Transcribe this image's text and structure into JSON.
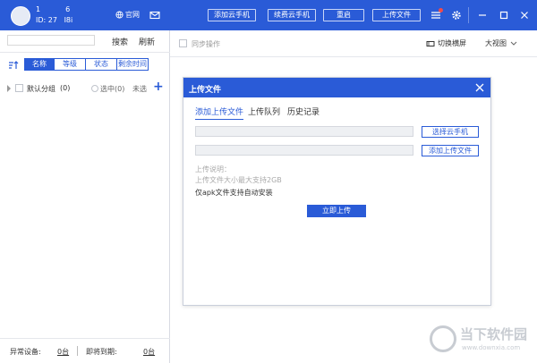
{
  "colors": {
    "accent": "#2a5bd7",
    "notify_dot": "#f24a4a"
  },
  "titlebar": {
    "user_name": "1           6",
    "user_id": "ID: 27   I8i",
    "official_label": "官网",
    "buttons": [
      "添加云手机",
      "续费云手机",
      "重启",
      "上传文件"
    ],
    "icons": [
      "globe-icon",
      "mail-icon",
      "menu-icon",
      "gear-icon",
      "minimize-icon",
      "maximize-icon",
      "close-icon"
    ]
  },
  "sidebar": {
    "search_placeholder": "",
    "search_label": "搜索",
    "refresh_label": "刷新",
    "sort_tabs": [
      "名称",
      "等级",
      "状态",
      "剩余时间"
    ],
    "active_sort": 0,
    "group": {
      "name": "默认分组",
      "count": "(0)",
      "selected_label": "选中(0)",
      "unselected_label": "未选"
    },
    "footer": {
      "abnormal_label": "异常设备:",
      "abnormal_count": "0台",
      "expiring_label": "即将到期:",
      "expiring_count": "0台"
    }
  },
  "main": {
    "sync_label": "同步操作",
    "switch_screen_label": "切换横屏",
    "view_label": "大视图"
  },
  "dialog": {
    "title": "上传文件",
    "tabs": [
      "添加上传文件",
      "上传队列",
      "历史记录"
    ],
    "active_tab": 0,
    "select_phone_label": "选择云手机",
    "add_file_label": "添加上传文件",
    "note_title": "上传说明：",
    "note_size": "上传文件大小最大支持2GB",
    "note_apk": "仅apk文件支持自动安装",
    "upload_now_label": "立即上传"
  },
  "watermark": {
    "title": "当下软件园",
    "url": "www.downxia.com"
  }
}
